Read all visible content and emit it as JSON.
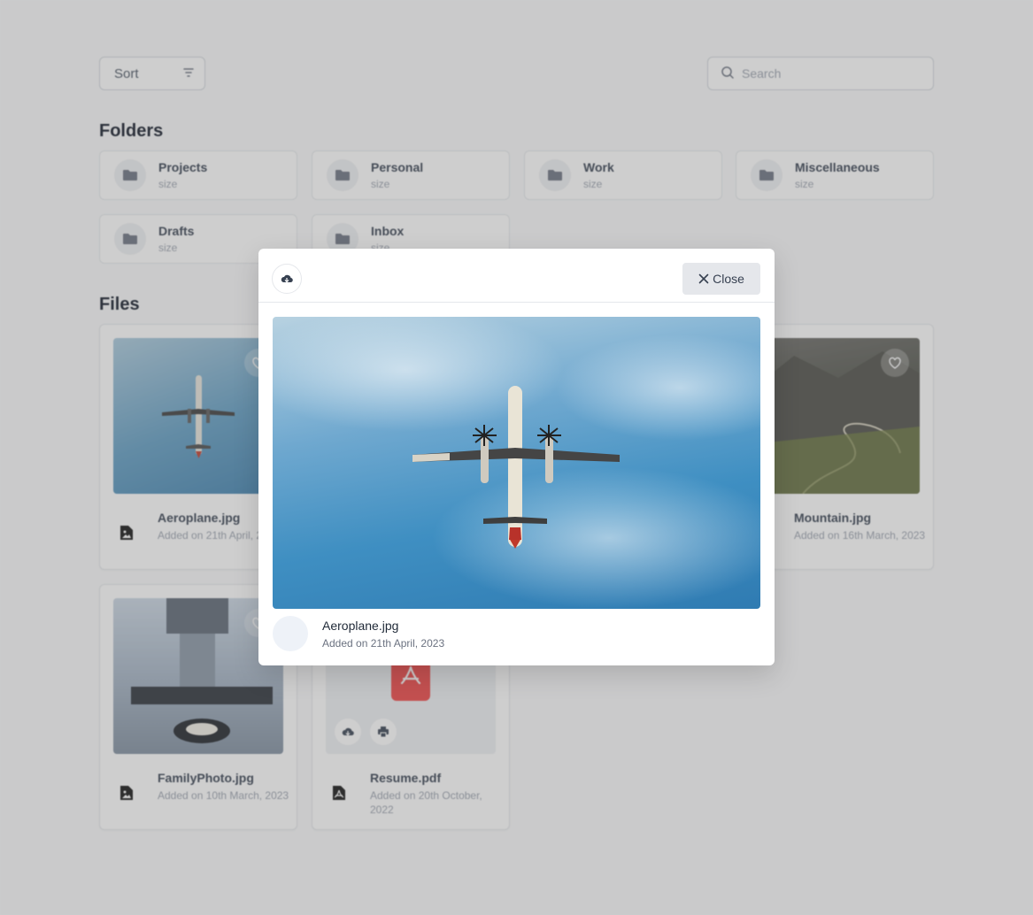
{
  "toolbar": {
    "sort_label": "Sort",
    "search_placeholder": "Search"
  },
  "folders_title": "Folders",
  "folders": [
    {
      "name": "Projects",
      "size": "size"
    },
    {
      "name": "Personal",
      "size": "size"
    },
    {
      "name": "Work",
      "size": "size"
    },
    {
      "name": "Miscellaneous",
      "size": "size"
    },
    {
      "name": "Drafts",
      "size": "size"
    },
    {
      "name": "Inbox",
      "size": "size"
    }
  ],
  "files_title": "Files",
  "files": [
    {
      "name": "Aeroplane.jpg",
      "date": "Added on 21th April, 2023",
      "icon": "image-file-icon"
    },
    {
      "name": "Mountain.jpg",
      "date": "Added on 16th March, 2023",
      "icon": "image-file-icon"
    },
    {
      "name": "FamilyPhoto.jpg",
      "date": "Added on 10th March, 2023",
      "icon": "image-file-icon"
    },
    {
      "name": "Resume.pdf",
      "date": "Added on 20th October, 2022",
      "icon": "pdf-file-icon"
    }
  ],
  "modal": {
    "close_label": "Close",
    "file_name": "Aeroplane.jpg",
    "file_date": "Added on 21th April, 2023"
  },
  "colors": {
    "overlay": "#6969694f",
    "pdf_red": "#ef4444",
    "sky": "#3a8fc4"
  }
}
